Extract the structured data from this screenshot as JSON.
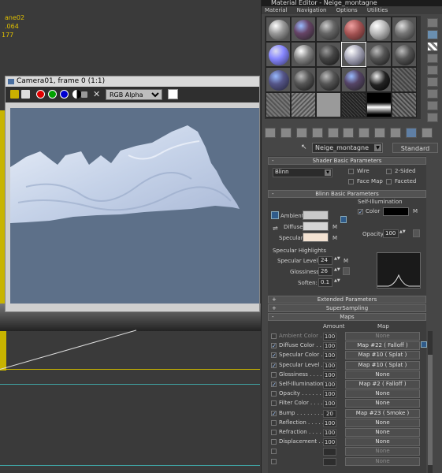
{
  "viewport": {
    "info_lines": [
      "ane02",
      ".064",
      "177"
    ]
  },
  "render_window": {
    "title": "Camera01, frame 0 (1:1)",
    "channel_select": "RGB Alpha",
    "toolbar_icons": [
      "save-icon",
      "clone-icon",
      "red-channel-icon",
      "green-channel-icon",
      "blue-channel-icon",
      "alpha-icon",
      "mono-icon",
      "clear-icon"
    ]
  },
  "material_editor": {
    "title": "Material Editor - Neige_montagne",
    "menu": [
      "Material",
      "Navigation",
      "Options",
      "Utilities"
    ],
    "material_name": "Neige_montagne",
    "type_button": "Standard",
    "rollouts": {
      "shader_basic": {
        "title": "Shader Basic Parameters",
        "shader": "Blinn",
        "wire": "Wire",
        "two_sided": "2-Sided",
        "face_map": "Face Map",
        "faceted": "Faceted"
      },
      "blinn_basic": {
        "title": "Blinn Basic Parameters",
        "self_illum_group": "Self-Illumination",
        "ambient": "Ambient:",
        "diffuse": "Diffuse:",
        "specular": "Specular:",
        "color": "Color",
        "m": "M",
        "opacity_label": "Opacity:",
        "opacity": "100",
        "spec_highlights": "Specular Highlights",
        "spec_level_label": "Specular Level:",
        "spec_level": "24",
        "glossiness_label": "Glossiness:",
        "glossiness": "26",
        "soften_label": "Soften:",
        "soften": "0.1"
      },
      "extended": "Extended Parameters",
      "supersampling": "SuperSampling",
      "maps": {
        "title": "Maps",
        "amount_header": "Amount",
        "map_header": "Map",
        "rows": [
          {
            "name": "Ambient Color . . . . .",
            "amount": "100",
            "map": "None",
            "checked": false,
            "dim": true
          },
          {
            "name": "Diffuse Color . . . . .",
            "amount": "100",
            "map": "Map #22  ( Falloff )",
            "checked": true,
            "dim": false
          },
          {
            "name": "Specular Color . . . .",
            "amount": "100",
            "map": "Map #10  ( Splat )",
            "checked": true,
            "dim": false
          },
          {
            "name": "Specular Level . . . .",
            "amount": "100",
            "map": "Map #10  ( Splat )",
            "checked": true,
            "dim": false
          },
          {
            "name": "Glossiness . . . . . .",
            "amount": "100",
            "map": "None",
            "checked": false,
            "dim": false
          },
          {
            "name": "Self-Illumination . . .",
            "amount": "100",
            "map": "Map #2  ( Falloff )",
            "checked": true,
            "dim": false
          },
          {
            "name": "Opacity . . . . . . . .",
            "amount": "100",
            "map": "None",
            "checked": false,
            "dim": false
          },
          {
            "name": "Filter Color . . . . .",
            "amount": "100",
            "map": "None",
            "checked": false,
            "dim": false
          },
          {
            "name": "Bump . . . . . . . . .",
            "amount": "20",
            "map": "Map #23  ( Smoke )",
            "checked": true,
            "dim": false
          },
          {
            "name": "Reflection . . . . . .",
            "amount": "100",
            "map": "None",
            "checked": false,
            "dim": false
          },
          {
            "name": "Refraction . . . . . .",
            "amount": "100",
            "map": "None",
            "checked": false,
            "dim": false
          },
          {
            "name": "Displacement . . . .",
            "amount": "100",
            "map": "None",
            "checked": false,
            "dim": false
          },
          {
            "name": "",
            "amount": "",
            "map": "None",
            "checked": false,
            "dim": true
          },
          {
            "name": "",
            "amount": "",
            "map": "None",
            "checked": false,
            "dim": true
          }
        ]
      }
    },
    "colors": {
      "ambient": "#c9c9c9",
      "diffuse": "#d4d4d4",
      "specular": "#f3e2d2",
      "self_illum": "#000000",
      "render_bg": "#5d7089"
    }
  }
}
